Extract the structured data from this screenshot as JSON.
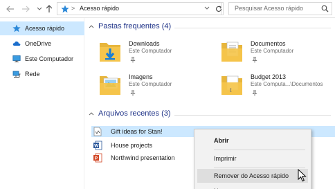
{
  "address_bar": {
    "path_separator": ">",
    "location": "Acesso rápido",
    "dropdown": "v"
  },
  "search": {
    "placeholder": "Pesquisar Acesso rápido"
  },
  "nav_pane": {
    "items": [
      {
        "label": "Acesso rápido",
        "selected": true
      },
      {
        "label": "OneDrive"
      },
      {
        "label": "Este Computador"
      },
      {
        "label": "Rede"
      }
    ]
  },
  "frequent": {
    "header": "Pastas frequentes (4)",
    "folders": [
      {
        "name": "Downloads",
        "location": "Este Computador"
      },
      {
        "name": "Documentos",
        "location": "Este Computador"
      },
      {
        "name": "Imagens",
        "location": "Este Computador"
      },
      {
        "name": "Budget 2013",
        "location": "Este Computa...\\Documentos"
      }
    ]
  },
  "recent": {
    "header": "Arquivos recentes (3)",
    "files": [
      {
        "name": "Gift ideas for Stan!",
        "selected": true
      },
      {
        "name": "House projects"
      },
      {
        "name": "Northwind presentation"
      }
    ]
  },
  "context_menu": {
    "items": [
      {
        "label": "Abrir",
        "bold": true
      },
      {
        "label": "Imprimir"
      },
      {
        "label": "Remover do Acesso rápido",
        "hover": true
      },
      {
        "label": "Na"
      }
    ]
  },
  "colors": {
    "selection": "#cce8ff",
    "group_header": "#1e3287",
    "folder_yellow": "#f5c54c",
    "quick_access_star": "#2b88d8"
  }
}
